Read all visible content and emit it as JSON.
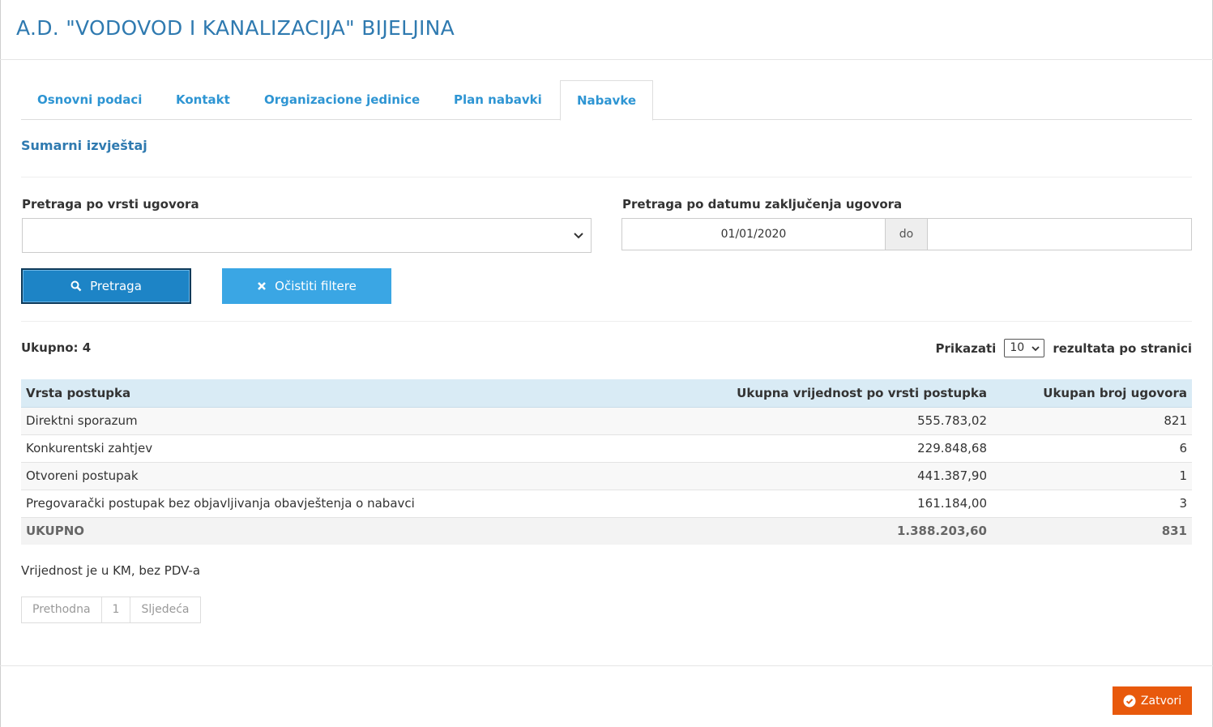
{
  "header": {
    "title": "A.D. \"VODOVOD I KANALIZACIJA\" BIJELJINA"
  },
  "tabs": [
    {
      "label": "Osnovni podaci"
    },
    {
      "label": "Kontakt"
    },
    {
      "label": "Organizacione jedinice"
    },
    {
      "label": "Plan nabavki"
    },
    {
      "label": "Nabavke",
      "active": true
    }
  ],
  "section": {
    "title": "Sumarni izvještaj"
  },
  "filters": {
    "contract_type_label": "Pretraga po vrsti ugovora",
    "contract_type_value": "",
    "date_label": "Pretraga po datumu zaključenja ugovora",
    "date_from": "01/01/2020",
    "date_sep": "do",
    "date_to": "",
    "search_button": "Pretraga",
    "clear_button": "Očistiti filtere"
  },
  "results": {
    "total_label": "Ukupno: 4",
    "show_label": "Prikazati",
    "per_page": "10",
    "per_page_suffix": "rezultata po stranici"
  },
  "table": {
    "headers": [
      "Vrsta postupka",
      "Ukupna vrijednost po vrsti postupka",
      "Ukupan broj ugovora"
    ],
    "rows": [
      [
        "Direktni sporazum",
        "555.783,02",
        "821"
      ],
      [
        "Konkurentski zahtjev",
        "229.848,68",
        "6"
      ],
      [
        "Otvoreni postupak",
        "441.387,90",
        "1"
      ],
      [
        "Pregovarački postupak bez objavljivanja obavještenja o nabavci",
        "161.184,00",
        "3"
      ]
    ],
    "total": [
      "UKUPNO",
      "1.388.203,60",
      "831"
    ]
  },
  "note": "Vrijednost je u KM, bez PDV-a",
  "pagination": {
    "prev": "Prethodna",
    "page": "1",
    "next": "Sljedeća"
  },
  "footer": {
    "close_button": "Zatvori"
  },
  "colors": {
    "primary": "#2e95d3",
    "title": "#2f7ab0",
    "close": "#e8590c",
    "table_header": "#d9ebf5"
  },
  "icons": {
    "search": "search-icon",
    "clear": "times-icon",
    "close": "check-circle-icon",
    "select": "chevron-down-icon"
  }
}
